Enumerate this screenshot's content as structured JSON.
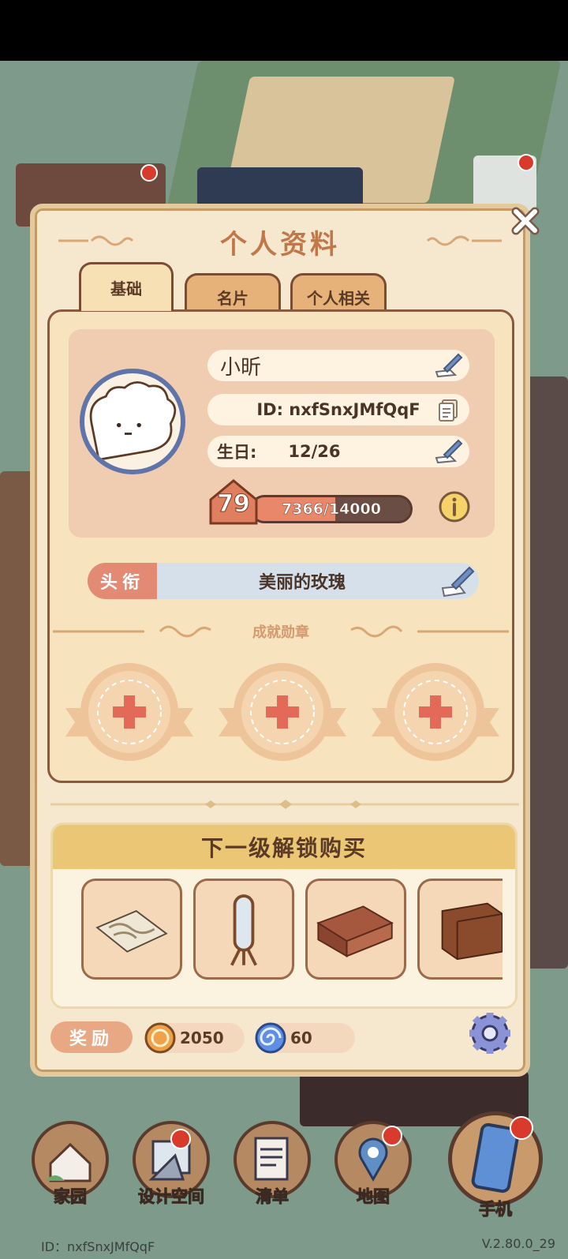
{
  "dialog": {
    "title": "个人资料",
    "tabs": [
      {
        "label": "基础",
        "active": true
      },
      {
        "label": "名片",
        "active": false
      },
      {
        "label": "个人相关",
        "active": false
      }
    ]
  },
  "profile": {
    "name": "小昕",
    "id_text": "ID: nxfSnxJMfQqF",
    "birthday_label": "生日:",
    "birthday_value": "12/26",
    "level": "79",
    "exp_text": "7366/14000",
    "exp_fraction": 0.526
  },
  "title_section": {
    "tag": "头衔",
    "value": "美丽的玫瑰"
  },
  "achievements": {
    "label": "成就勋章",
    "slots": 3
  },
  "unlock": {
    "header": "下一级解锁购买",
    "items": [
      "rug-icon",
      "mirror-icon",
      "sofa-icon",
      "cabinet-icon"
    ]
  },
  "rewards": {
    "tag": "奖励",
    "coins": "2050",
    "gems": "60"
  },
  "nav": {
    "items": [
      {
        "label": "家园",
        "icon": "home-icon"
      },
      {
        "label": "设计空间",
        "icon": "design-icon"
      },
      {
        "label": "清单",
        "icon": "list-icon"
      },
      {
        "label": "地图",
        "icon": "map-pin-icon"
      },
      {
        "label": "手机",
        "icon": "phone-icon"
      }
    ]
  },
  "footer": {
    "id": "ID：nxfSnxJMfQqF",
    "version": "V.2.80.0_29"
  },
  "colors": {
    "dialog_bg": "#f6e8cf",
    "accent": "#c0784a",
    "title_tag": "#e28a74",
    "unlock_header": "#ebc775"
  }
}
